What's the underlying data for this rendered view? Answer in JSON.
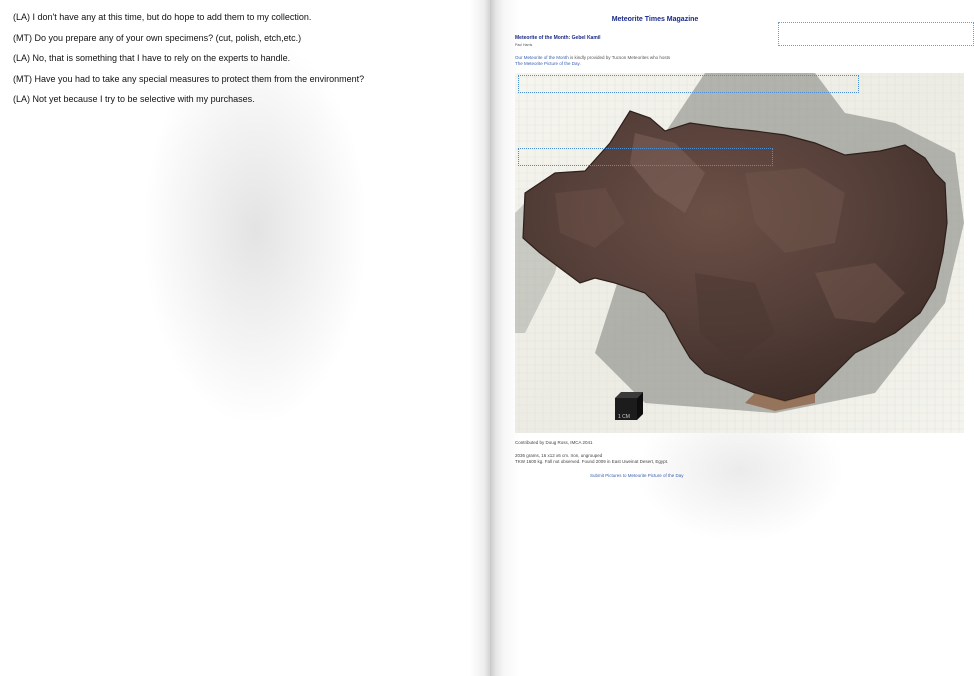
{
  "left_page": {
    "lines": [
      "(LA) I don't have any at this time, but do hope to add them to my collection.",
      "(MT) Do you prepare any of your own specimens? (cut, polish, etch,etc.)",
      "(LA) No, that is something that I have to rely on the experts to handle.",
      "(MT) Have you had to take any special measures to protect them from the environment?",
      "(LA) Not yet because I try to be selective with my purchases."
    ]
  },
  "right_page": {
    "magazine_title": "Meteorite Times Magazine",
    "motm_title": "Meteorite of the Month: Gebel Kamil",
    "motm_subtitle": "Paul Harris",
    "intro_line1_link": "Our Meteorite of the Month",
    "intro_line1_rest": " is kindly provided by Tucson Meteorites who hosts",
    "intro_line2_link": "The Meteorite Picture of the Day.",
    "scale_cube_label": "1 CM",
    "contributed_by": "Contributed by Doug Ross, IMCA 2041",
    "specimen_line1": "2036 grams, 16 x12 x6 cm. Iron, ungrouped",
    "specimen_line2": "TKW 1600 kg. Fall not observed. Found 2009 in East Uweinat Desert, Egypt.",
    "submit_link": "Submit Pictures to Meteorite Picture of the Day"
  },
  "colors": {
    "heading_blue": "#1a2a88",
    "link_blue": "#3b5fb0",
    "dotted_box": "#4f8fd0",
    "meteorite_brown": "#5a3f33"
  }
}
